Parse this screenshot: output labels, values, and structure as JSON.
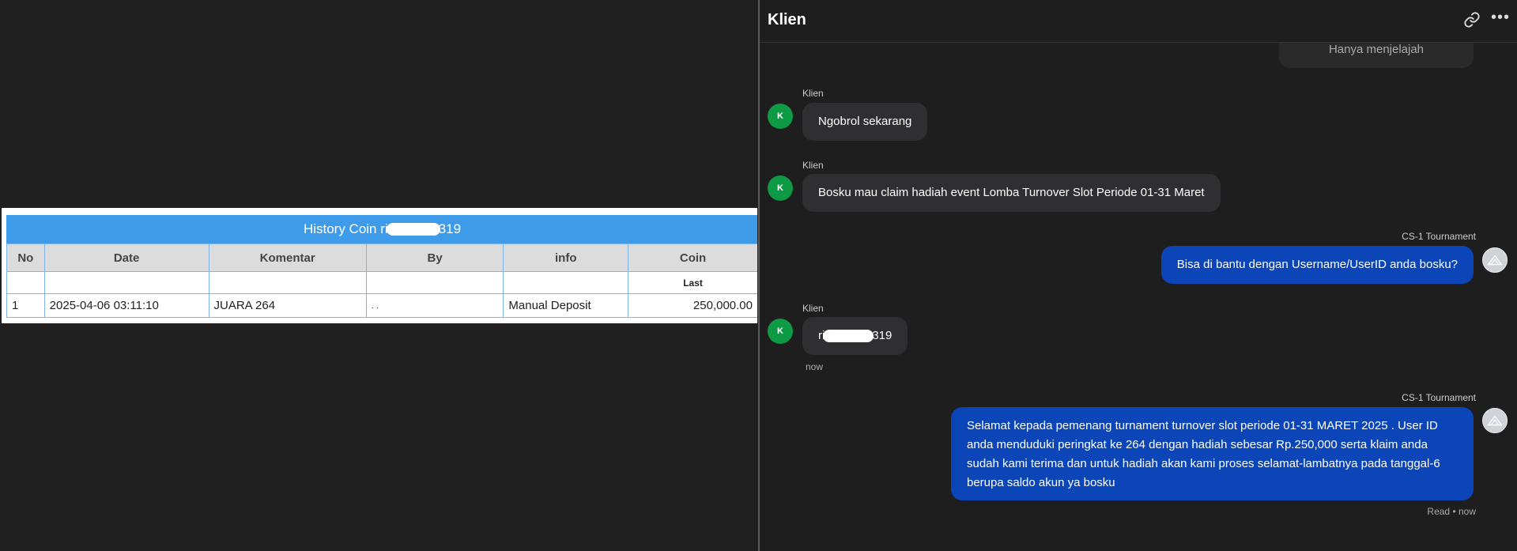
{
  "history": {
    "title_prefix": "History Coin ri",
    "title_suffix": "319",
    "columns": [
      "No",
      "Date",
      "Komentar",
      "By",
      "info",
      "Coin"
    ],
    "sub_header": "Last",
    "rows": [
      {
        "no": "1",
        "date": "2025-04-06 03:11:10",
        "komentar": "JUARA 264",
        "by": ". .",
        "info": "Manual Deposit",
        "coin": "250,000.00"
      }
    ]
  },
  "chat": {
    "title": "Klien",
    "previous_message": "Hanya menjelajah",
    "messages": [
      {
        "sender": "Klien",
        "avatar": "K",
        "text": "Ngobrol sekarang"
      },
      {
        "sender": "Klien",
        "avatar": "K",
        "text": "Bosku mau claim hadiah event Lomba Turnover Slot Periode 01-31 Maret"
      },
      {
        "sender": "CS-1 Tournament",
        "text": "Bisa di bantu dengan Username/UserID anda bosku?"
      },
      {
        "sender": "Klien",
        "avatar": "K",
        "text_prefix": "ri",
        "text_suffix": "319",
        "time": "now"
      },
      {
        "sender": "CS-1 Tournament",
        "text": "Selamat kepada pemenang turnament turnover slot periode 01-31 MARET 2025 . User ID anda menduduki peringkat ke 264 dengan hadiah sebesar Rp.250,000 serta klaim anda sudah kami terima dan untuk hadiah akan kami proses selamat-lambatnya pada tanggal-6 berupa saldo akun ya bosku",
        "status": "Read • now"
      }
    ]
  },
  "colors": {
    "table_header": "#3d9be9",
    "coin_green": "#2d8a2d",
    "agent_bubble": "#0b45b8",
    "client_avatar": "#0e9a45"
  },
  "icons": [
    "link-icon",
    "more-icon",
    "agent-avatar-icon"
  ]
}
